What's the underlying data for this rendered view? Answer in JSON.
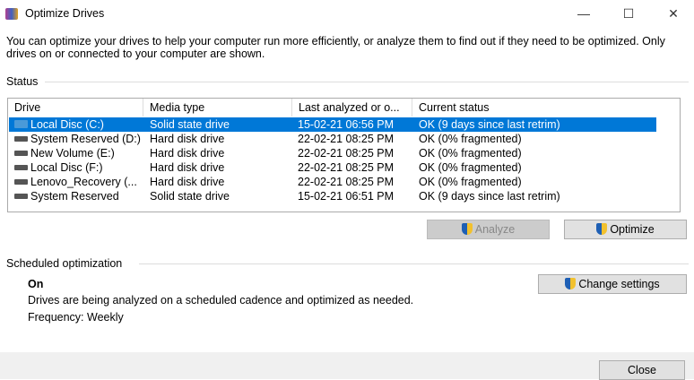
{
  "window": {
    "title": "Optimize Drives",
    "minimize": "—",
    "maximize": "☐",
    "close": "✕"
  },
  "description": "You can optimize your drives to help your computer run more efficiently, or analyze them to find out if they need to be optimized. Only drives on or connected to your computer are shown.",
  "status": {
    "label": "Status",
    "columns": [
      "Drive",
      "Media type",
      "Last analyzed or o...",
      "Current status"
    ],
    "rows": [
      {
        "drive": "Local Disc (C:)",
        "media": "Solid state drive",
        "last": "15-02-21 06:56 PM",
        "status": "OK (9 days since last retrim)",
        "icon": "ssd-icon",
        "selected": true
      },
      {
        "drive": "System Reserved (D:)",
        "media": "Hard disk drive",
        "last": "22-02-21 08:25 PM",
        "status": "OK (0% fragmented)",
        "icon": "hdd-icon"
      },
      {
        "drive": "New Volume (E:)",
        "media": "Hard disk drive",
        "last": "22-02-21 08:25 PM",
        "status": "OK (0% fragmented)",
        "icon": "hdd-icon"
      },
      {
        "drive": "Local Disc (F:)",
        "media": "Hard disk drive",
        "last": "22-02-21 08:25 PM",
        "status": "OK (0% fragmented)",
        "icon": "hdd-icon"
      },
      {
        "drive": "Lenovo_Recovery (...",
        "media": "Hard disk drive",
        "last": "22-02-21 08:25 PM",
        "status": "OK (0% fragmented)",
        "icon": "hdd-icon"
      },
      {
        "drive": "System Reserved",
        "media": "Solid state drive",
        "last": "15-02-21 06:51 PM",
        "status": "OK (9 days since last retrim)",
        "icon": "hdd-icon"
      }
    ],
    "analyze": "Analyze",
    "optimize": "Optimize"
  },
  "scheduled": {
    "label": "Scheduled optimization",
    "state": "On",
    "text": "Drives are being analyzed on a scheduled cadence and optimized as needed.",
    "frequency": "Frequency: Weekly",
    "change": "Change settings"
  },
  "footer": {
    "close": "Close"
  }
}
